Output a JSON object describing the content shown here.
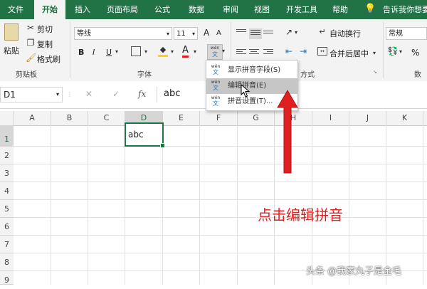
{
  "colors": {
    "brand": "#217346",
    "arrow": "#e02020",
    "annotation": "#e02020"
  },
  "menubar": {
    "tabs": [
      "文件",
      "开始",
      "插入",
      "页面布局",
      "公式",
      "数据",
      "审阅",
      "视图",
      "开发工具",
      "帮助"
    ],
    "active_tab": "开始",
    "search_hint": "告诉我你想要"
  },
  "ribbon": {
    "clipboard": {
      "paste": "粘贴",
      "cut": "剪切",
      "copy": "复制",
      "format_painter": "格式刷",
      "label": "剪贴板"
    },
    "font": {
      "font_name": "等线",
      "font_size": "11",
      "bold": "B",
      "italic": "I",
      "underline": "U",
      "grow": "A",
      "shrink": "A",
      "font_color": "A",
      "label": "字体"
    },
    "alignment": {
      "wrap": "自动换行",
      "merge": "合并后居中",
      "label": "方式"
    },
    "number": {
      "format": "常规",
      "percent": "%",
      "label": "数字"
    }
  },
  "phonetic_menu": {
    "items": [
      {
        "label": "显示拼音字段(S)",
        "icon": "wen"
      },
      {
        "label": "编辑拼音(E)",
        "icon": "wen"
      },
      {
        "label": "拼音设置(T)...",
        "icon": "wen"
      }
    ],
    "highlighted": "编辑拼音(E)",
    "icon_top": "wén",
    "icon_bottom": "文"
  },
  "formula_bar": {
    "name_box": "D1",
    "fx": "fx",
    "value": "abc",
    "cancel": "✕",
    "enter": "✓"
  },
  "grid": {
    "columns": [
      "A",
      "B",
      "C",
      "D",
      "E",
      "F",
      "G",
      "H",
      "I",
      "J",
      "K"
    ],
    "rows": [
      "1",
      "2",
      "3",
      "4",
      "5",
      "6",
      "7",
      "8",
      "9"
    ],
    "active_cell": "D1",
    "cell_D1": "abc"
  },
  "annotation": {
    "text": "点击编辑拼音"
  },
  "watermark": {
    "text": "头条 @我家丸子是金毛"
  }
}
